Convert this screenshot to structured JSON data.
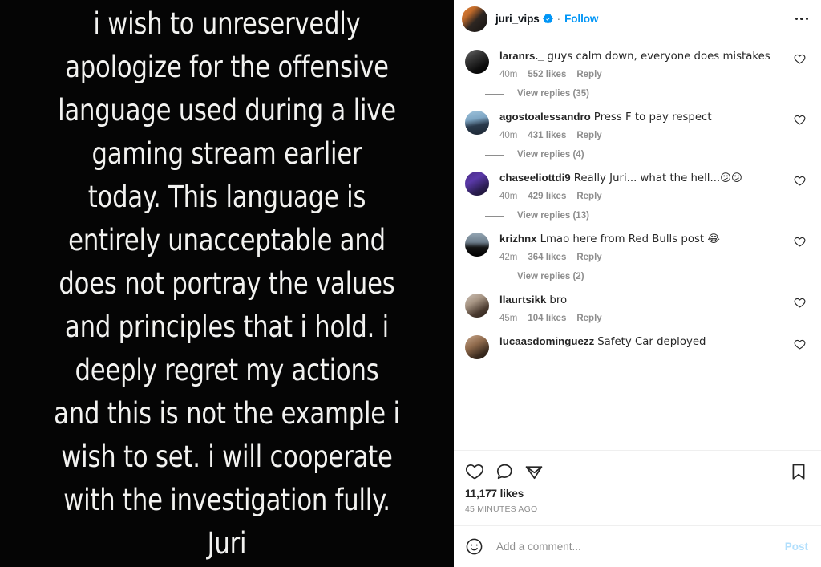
{
  "media": {
    "background_color": "#050505",
    "text_color": "#f2f2f0",
    "story_text": "i wish to unreservedly apologize for the offensive language used during a live gaming stream earlier today. This language is entirely unacceptable and does not portray the values and principles that i hold. i deeply regret my actions and this is not the example i wish to set. i will cooperate with the investigation fully. Juri"
  },
  "header": {
    "username": "juri_vips",
    "verified": true,
    "verified_color": "#0095f6",
    "separator": "·",
    "follow_label": "Follow",
    "more_icon": "more-options-icon"
  },
  "comments": [
    {
      "username": "laranrs._",
      "text": "guys calm down, everyone does mistakes",
      "time": "40m",
      "likes": "552 likes",
      "reply_label": "Reply",
      "view_replies": "View replies (35)",
      "avatar_class": "av-laranrs"
    },
    {
      "username": "agostoalessandro",
      "text": "Press F to pay respect",
      "time": "40m",
      "likes": "431 likes",
      "reply_label": "Reply",
      "view_replies": "View replies (4)",
      "avatar_class": "av-agosto"
    },
    {
      "username": "chaseeliottdi9",
      "text": "Really Juri... what the hell...😕😕",
      "time": "40m",
      "likes": "429 likes",
      "reply_label": "Reply",
      "view_replies": "View replies (13)",
      "avatar_class": "av-chase"
    },
    {
      "username": "krizhnx",
      "text": "Lmao here from Red Bulls post 😂",
      "time": "42m",
      "likes": "364 likes",
      "reply_label": "Reply",
      "view_replies": "View replies (2)",
      "avatar_class": "av-krizhnx"
    },
    {
      "username": "llaurtsikk",
      "text": "bro",
      "time": "45m",
      "likes": "104 likes",
      "reply_label": "Reply",
      "view_replies": "",
      "avatar_class": "av-llaurt"
    },
    {
      "username": "lucaasdominguezz",
      "text": "Safety Car deployed",
      "time": "",
      "likes": "",
      "reply_label": "",
      "view_replies": "",
      "avatar_class": "av-lucaas"
    }
  ],
  "actions": {
    "like_icon": "heart-icon",
    "comment_icon": "speech-bubble-icon",
    "share_icon": "paper-plane-icon",
    "save_icon": "bookmark-icon",
    "likes_count": "11,177 likes",
    "timestamp": "45 MINUTES AGO"
  },
  "add_comment": {
    "emoji_icon": "smiley-face-icon",
    "placeholder": "Add a comment...",
    "value": "",
    "post_label": "Post",
    "post_color": "#b2dffc"
  }
}
